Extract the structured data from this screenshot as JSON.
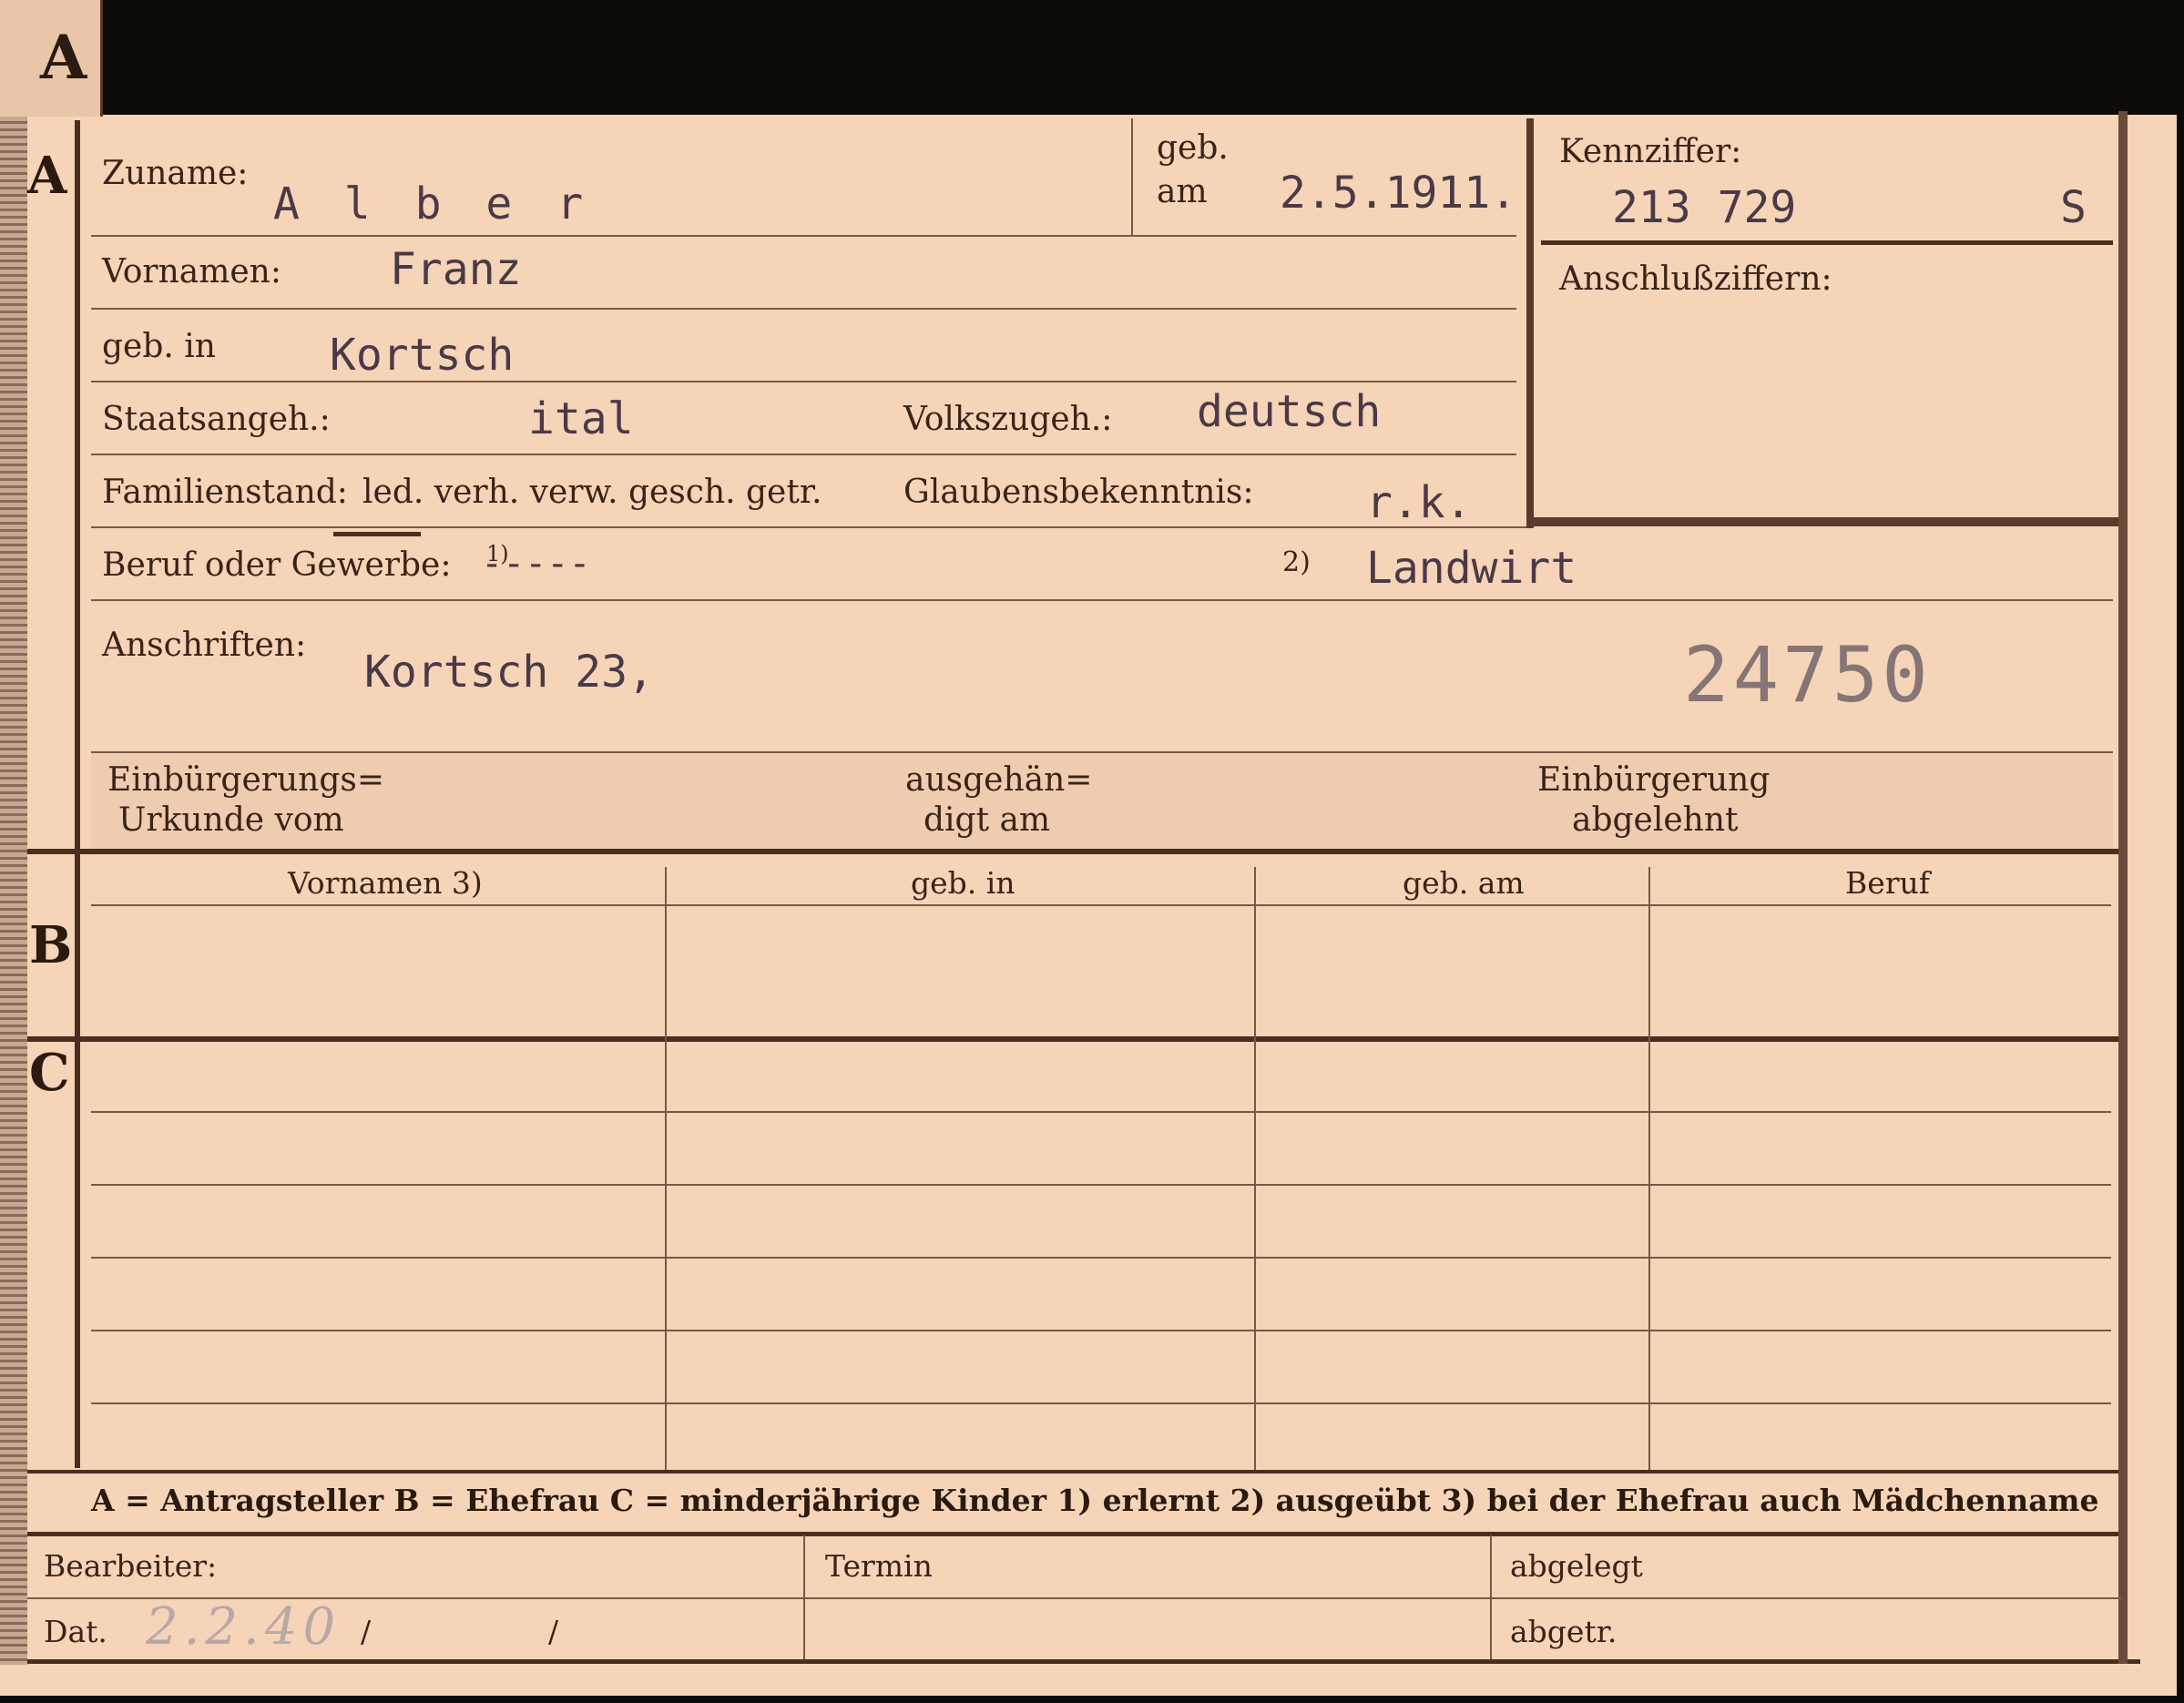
{
  "tab_letter": "A",
  "sections": {
    "a": "A",
    "b": "B",
    "c": "C"
  },
  "fields": {
    "zuname_label": "Zuname:",
    "zuname_value": "A l b e r",
    "geb_label": "geb.",
    "am_label": "am",
    "geb_am_value": "2.5.1911.",
    "kennziffer_label": "Kennziffer:",
    "kennziffer_value": "213 729",
    "kennziffer_suffix": "S",
    "anschlussziffern_label": "Anschlußziffern:",
    "vornamen_label": "Vornamen:",
    "vornamen_value": "Franz",
    "geb_in_label": "geb. in",
    "geb_in_value": "Kortsch",
    "staatsangeh_label": "Staatsangeh.:",
    "staatsangeh_value": "ital",
    "volkszugeh_label": "Volkszugeh.:",
    "volkszugeh_value": "deutsch",
    "familienstand_label": "Familienstand:",
    "familienstand_options": "led. verh. verw. gesch. getr.",
    "glaubens_label": "Glaubensbekenntnis:",
    "glaubens_value": "r.k.",
    "beruf_label": "Beruf oder Gewerbe:",
    "beruf_1_marker": "1)",
    "beruf_1_value": "-----",
    "beruf_2_marker": "2)",
    "beruf_2_value": "Landwirt",
    "anschriften_label": "Anschriften:",
    "anschriften_value": "Kortsch 23,",
    "stamp_number": "24750",
    "einb_urkunde_line1": "Einbürgerungs=",
    "einb_urkunde_line2": "Urkunde vom",
    "ausgehaendigt_line1": "ausgehän=",
    "ausgehaendigt_line2": "digt am",
    "einb_abgelehnt_line1": "Einbürgerung",
    "einb_abgelehnt_line2": "abgelehnt"
  },
  "table_headers": [
    "Vornamen 3)",
    "geb. in",
    "geb. am",
    "Beruf"
  ],
  "legend": "A = Antragsteller   B = Ehefrau   C = minderjährige Kinder   1) erlernt   2) ausgeübt   3) bei der Ehefrau auch Mädchenname",
  "footer": {
    "bearbeiter_label": "Bearbeiter:",
    "dat_label": "Dat.",
    "dat_value": "2.2.40",
    "slash1": "/",
    "slash2": "/",
    "termin_label": "Termin",
    "abgelegt_label": "abgelegt",
    "abgetr_label": "abgetr."
  }
}
